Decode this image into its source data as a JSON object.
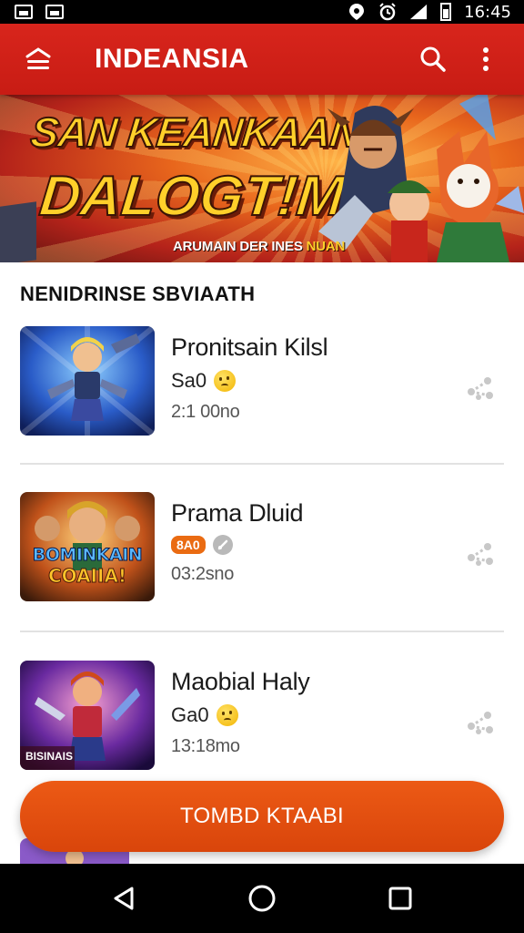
{
  "status_bar": {
    "time": "16:45"
  },
  "app_bar": {
    "title": "INDEANSIA"
  },
  "banner": {
    "line1": "SAN KEANKAAN",
    "line2": "DALOGT!M",
    "line3a": "ARUMAIN DER INES ",
    "line3b": "NUAN"
  },
  "section": {
    "title": "NENIDRINSE SBVIAATH"
  },
  "items": [
    {
      "name": "Pronitsain Kilsl",
      "sub": "Sa0",
      "meta": "2:1 00no",
      "thumb_text": ""
    },
    {
      "name": "Prama Dluid",
      "sub": "",
      "badge": "8A0",
      "meta": "03:2sno",
      "thumb_text_1": "BOMINKAIN",
      "thumb_text_2": "COAIIA!"
    },
    {
      "name": "Maobial Haly",
      "sub": "Ga0",
      "meta": "13:18mo",
      "thumb_text": "BISINAIS"
    }
  ],
  "cta": {
    "label": "TOMBD KTAABI"
  },
  "colors": {
    "accent": "#c81c14",
    "cta": "#e04c0e"
  }
}
